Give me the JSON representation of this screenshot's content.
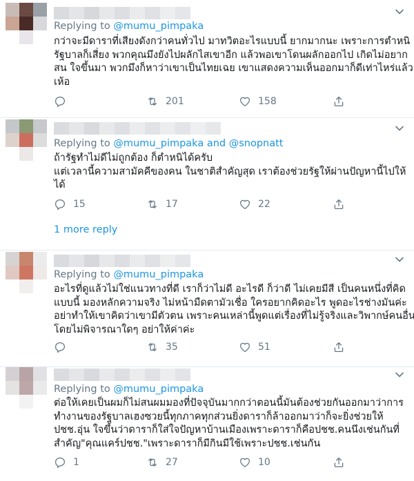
{
  "tweets": [
    {
      "replying_prefix": "Replying to",
      "mentions": "@mumu_pimpaka",
      "lines": [
        "กว่าจะมีดาราที่เสียงดังกว่าคนทั่วไป มาทวิตอะไรแบบนี้ ยากมากนะ เพราะการตำหนิ",
        "รัฐบาลก็เสี่ยง พวกคุณมึงยังไปผลักไสเขาอีก แล้วพอเขาโดนผลักออกไป เกิดไม่อยาก",
        "สน ใจขึ้นมา พวกมึงก็หาว่าเขาเป็นไทยเฉย เขาแสดงความเห็นออกมาก็ดีเท่าไหร่แล้ว",
        "เห้อ"
      ],
      "reply_count": "",
      "retweet_count": "201",
      "like_count": "158"
    },
    {
      "replying_prefix": "Replying to",
      "mentions": "@mumu_pimpaka and @snopnatt",
      "lines": [
        "ถ้ารัฐทำไม่ดีไม่ถูกต้อง ก็ตำหนิได้ครับ",
        "แต่เวลานี้ความสามัคคีของคน ในชาติสำคัญสุด เราต้องช่วยรัฐให้ผ่านปัญหานี้ไปให้",
        "ได้"
      ],
      "reply_count": "15",
      "retweet_count": "17",
      "like_count": "22",
      "more_replies": "1 more reply"
    },
    {
      "replying_prefix": "Replying to",
      "mentions": "@mumu_pimpaka",
      "lines": [
        "อะไรที่ดูแล้วไม่ใช่แนวทางที่ดี เราก็ว่าไม่ดี อะไรดี ก็ว่าดี ไม่เคยมีสี เป็นคนหนึ่งที่คิด",
        "แบบนี้ มองหลักความจริง ไม่หน้ามืดตามัวเชื่อ ใครอยากคิดอะไร พูดอะไรช่างมันค่ะ",
        "อย่าทำให้เขาคิดว่าเขามีตัวตน เพราะคนเหล่านี้พูดแต่เรื่องที่ไม่รู้จริงและวิพากษ์คนอื่น",
        "โดยไม่พิจารณาใดๆ อย่าให้ค่าค่ะ"
      ],
      "reply_count": "",
      "retweet_count": "35",
      "like_count": "51"
    },
    {
      "replying_prefix": "Replying to",
      "mentions": "@mumu_pimpaka",
      "lines": [
        "ต่อให้เคยเป็นผมก็ไม่สนผมมองที่ปัจจุบันมากกว่าตอนนี้มันต้องช่วยกันออกมาว่าการ",
        "ทำงานของรัฐบาลเฮงซวยนี้ทุกภาคทุกส่วนยิ่งดาราก็ล้าออกมาว่าก็จะยิ่งช่วยให้",
        "ปชช.อุ่น ใจขึ้นว่าดาราก็ใส่ใจปัญหาบ้านเมืองเพราะดาราก็คือปชช.คนนึงเช่นกันที่",
        "สำคัญ\"คุณแคร์ปชช.\"เพราะดาราก็มีกินมีใช้เพราะปชช.เช่นกัน"
      ],
      "reply_count": "1",
      "retweet_count": "27",
      "like_count": "10"
    }
  ],
  "colors": {
    "accent": "#1b95e0",
    "muted": "#657786",
    "text": "#14171a",
    "divider": "#e6ecf0"
  },
  "icons": {
    "reply": "reply-icon",
    "retweet": "retweet-icon",
    "like": "heart-icon",
    "share": "share-icon",
    "menu": "chevron-down-icon"
  }
}
